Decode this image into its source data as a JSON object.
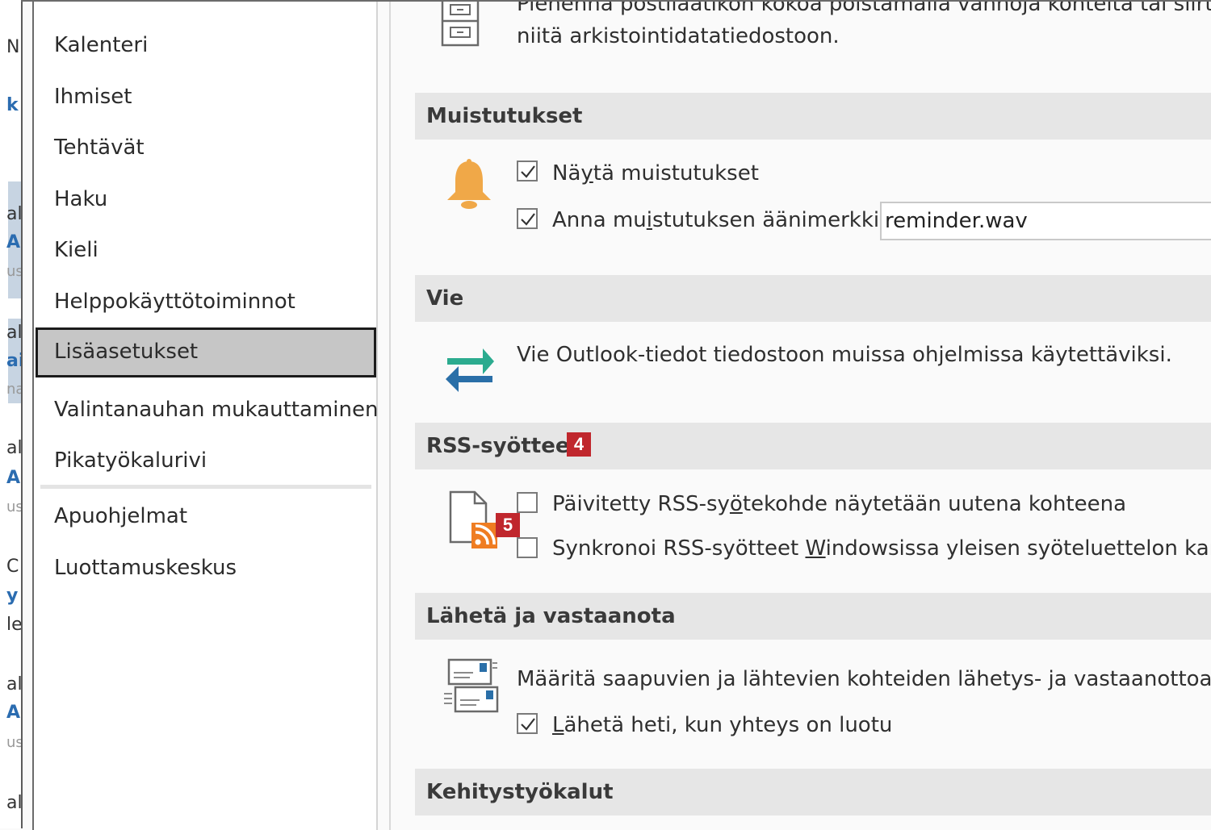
{
  "background_window": {
    "fragments": [
      "N",
      "k",
      "al",
      "A",
      "us",
      "al",
      "ai",
      "na",
      "al",
      "A",
      "us",
      "C",
      "y",
      "le",
      "al",
      "A",
      "us",
      "al"
    ]
  },
  "nav": {
    "items": [
      {
        "label": "Kalenteri"
      },
      {
        "label": "Ihmiset"
      },
      {
        "label": "Tehtävät"
      },
      {
        "label": "Haku"
      },
      {
        "label": "Kieli"
      },
      {
        "label": "Helppokäyttötoiminnot"
      },
      {
        "label": "Lisäasetukset",
        "selected": true
      },
      {
        "label": "Valintanauhan mukauttaminen"
      },
      {
        "label": "Pikatyökalurivi"
      },
      {
        "label": "Apuohjelmat"
      },
      {
        "label": "Luottamuskeskus"
      }
    ]
  },
  "archive": {
    "line1": "Pienennä postilaatikon kokoa poistamalla vanhoja kohteita tai siirtämällä",
    "line2": "niitä arkistointidatatiedostoon."
  },
  "reminders": {
    "header": "Muistutukset",
    "show_reminders": {
      "label_pre": "Nä",
      "label_acc": "y",
      "label_post": "tä muistutukset",
      "checked": true
    },
    "play_sound": {
      "label_pre": "Anna mu",
      "label_acc": "i",
      "label_post": "stutuksen äänimerkki:",
      "checked": true
    },
    "sound_file": "reminder.wav"
  },
  "export": {
    "header": "Vie",
    "description": "Vie Outlook-tiedot tiedostoon muissa ohjelmissa käytettäviksi."
  },
  "rss": {
    "header": "RSS-syötteet",
    "header_badge": "4",
    "icon_badge": "5",
    "option1": {
      "label_pre": "Päivitetty RSS-sy",
      "label_acc": "ö",
      "label_post": "tekohde näytetään uutena kohteena",
      "checked": false
    },
    "option2": {
      "label_pre": "Synkronoi RSS-syötteet ",
      "label_acc": "W",
      "label_post": "indowsissa yleisen syöteluettelon kanssa",
      "checked": false
    }
  },
  "send_receive": {
    "header": "Lähetä ja vastaanota",
    "description": "Määritä saapuvien ja lähtevien kohteiden lähetys- ja vastaanottoasetukset.",
    "send_immediately": {
      "label_acc": "L",
      "label_post": "ähetä heti, kun yhteys on luotu",
      "checked": true
    }
  },
  "dev_tools": {
    "header": "Kehitystyökalut"
  },
  "colors": {
    "accent_badge": "#c0272d",
    "bell": "#f0a848",
    "arrow_green": "#2bab8f",
    "arrow_blue": "#2a6fa8",
    "rss_orange": "#ef7d22"
  }
}
